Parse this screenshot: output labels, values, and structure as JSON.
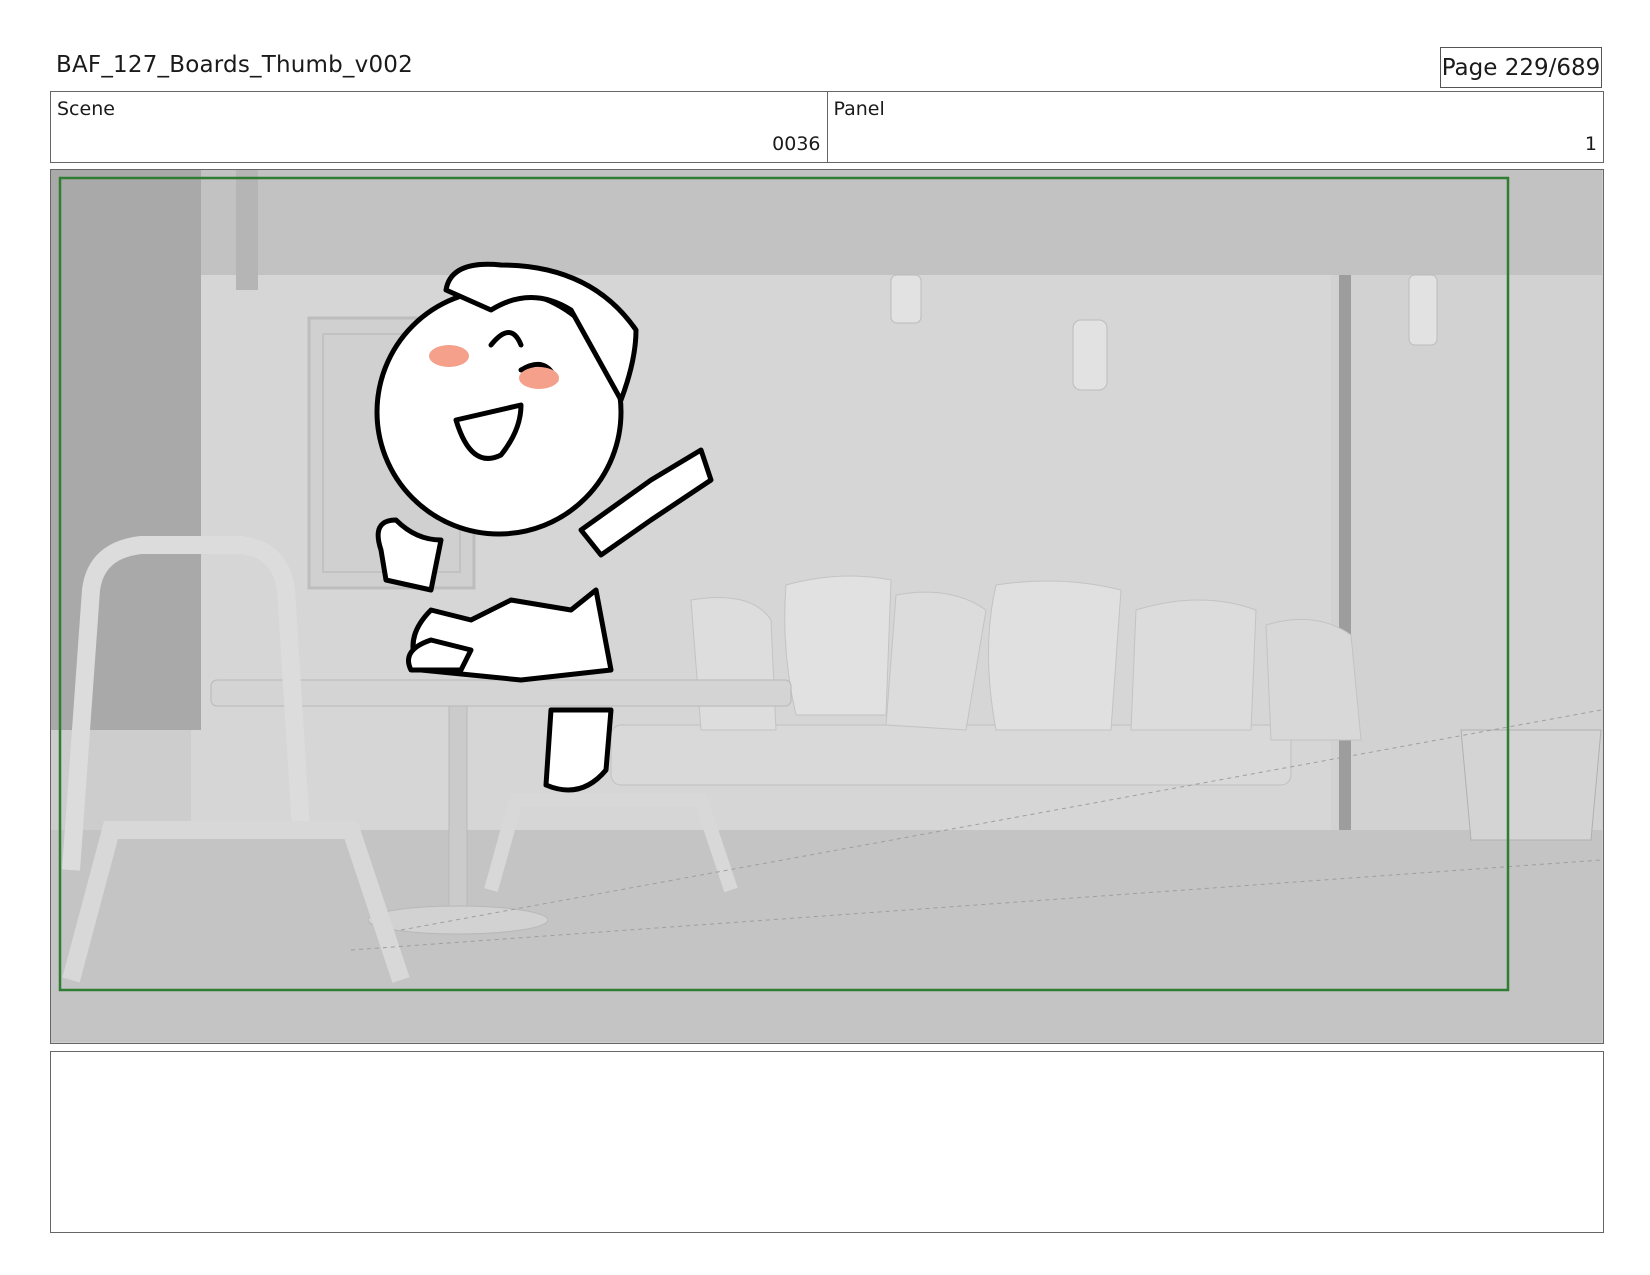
{
  "document": {
    "title": "BAF_127_Boards_Thumb_v002",
    "page_label": "Page 229/689"
  },
  "header": {
    "scene_label": "Scene",
    "scene_value": "0036",
    "panel_label": "Panel",
    "panel_value": "1"
  },
  "panel_image": {
    "safe_frame_color": "#2e7d32",
    "blush_color": "#f4a08a"
  },
  "notes": {
    "text": ""
  }
}
